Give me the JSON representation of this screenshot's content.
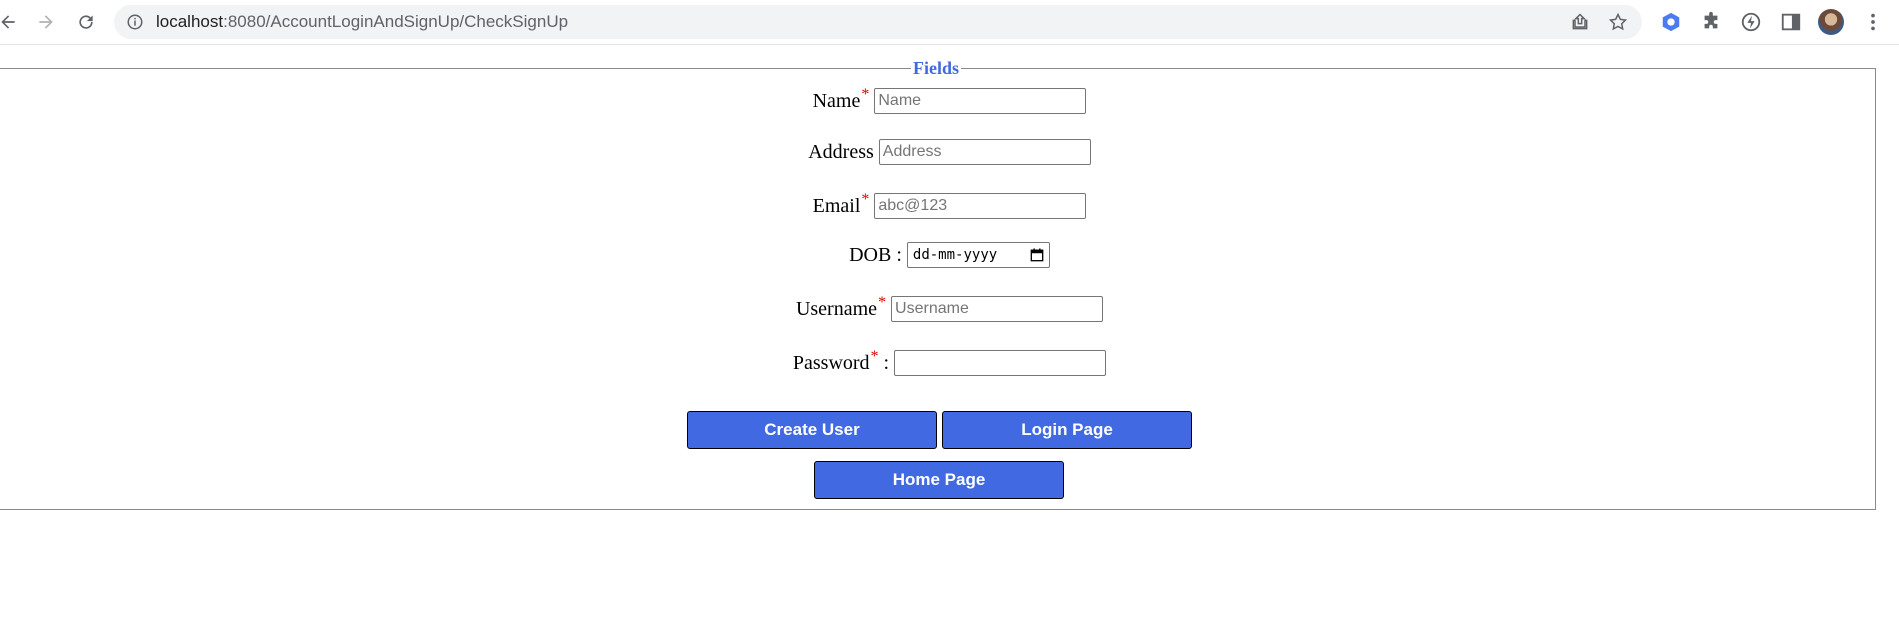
{
  "browser": {
    "url_host": "localhost",
    "url_rest": ":8080/AccountLoginAndSignUp/CheckSignUp"
  },
  "form": {
    "legend": "Fields",
    "name": {
      "label": "Name",
      "required_mark": "*",
      "placeholder": "Name"
    },
    "address": {
      "label": "Address",
      "placeholder": "Address"
    },
    "email": {
      "label": "Email",
      "required_mark": "*",
      "placeholder": "abc@123"
    },
    "dob": {
      "label": "DOB :",
      "placeholder": "dd-mm-yyyy"
    },
    "username": {
      "label": "Username",
      "required_mark": "*",
      "placeholder": "Username"
    },
    "password": {
      "label": "Password",
      "required_mark": "*",
      "suffix": " :"
    }
  },
  "buttons": {
    "create_user": "Create User",
    "login_page": "Login Page",
    "home_page": "Home Page"
  },
  "colors": {
    "accent": "#4169e1",
    "required": "#e00000"
  }
}
